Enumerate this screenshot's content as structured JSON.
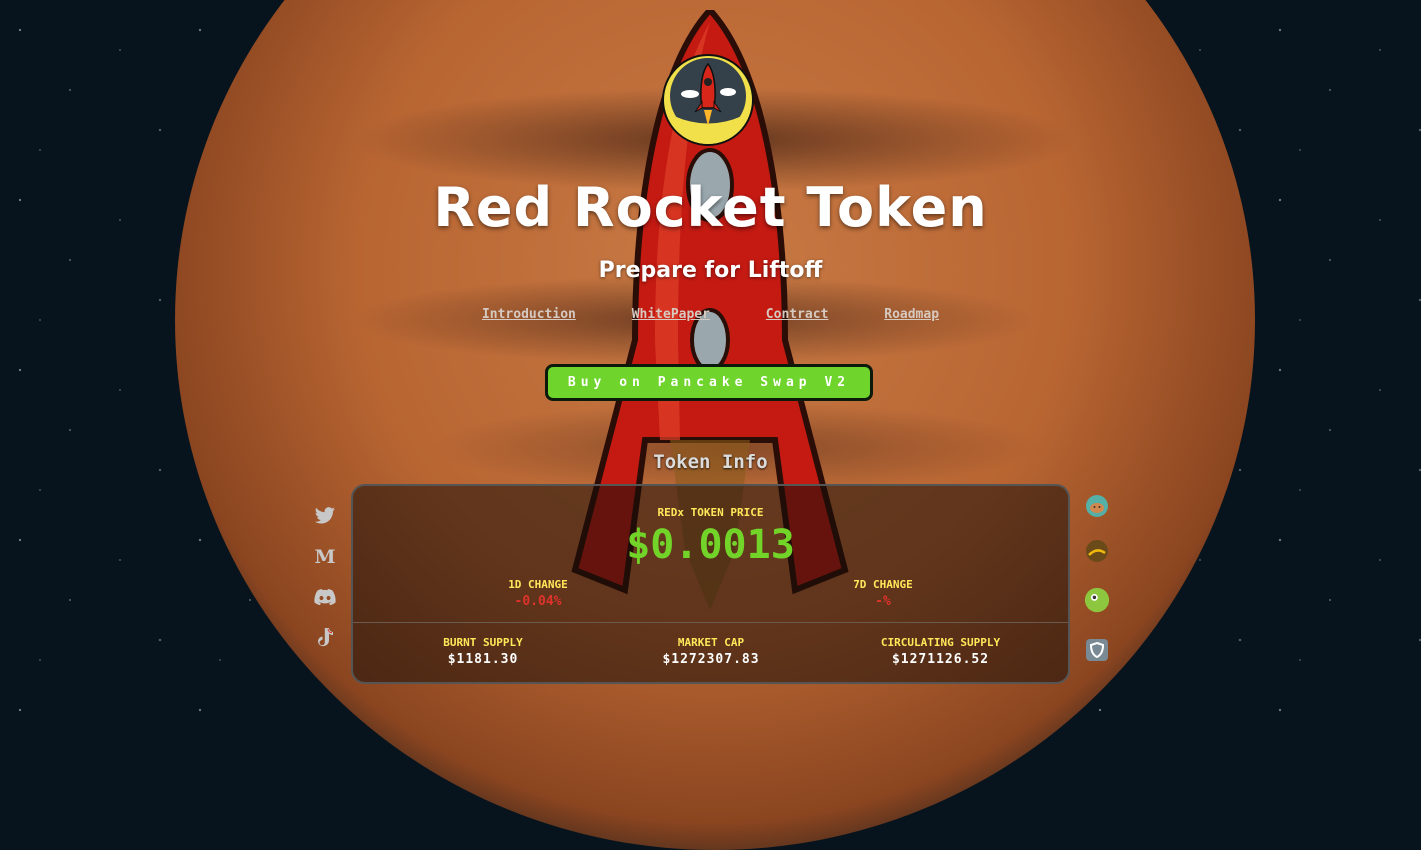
{
  "header": {
    "title": "Red Rocket Token",
    "subtitle": "Prepare for Liftoff"
  },
  "nav": [
    {
      "label": "Introduction"
    },
    {
      "label": "WhitePaper"
    },
    {
      "label": "Contract"
    },
    {
      "label": "Roadmap"
    }
  ],
  "buy_button": {
    "label": "Buy on Pancake Swap V2"
  },
  "token_info": {
    "heading": "Token Info",
    "price_label": "REDx TOKEN PRICE",
    "price": "$0.0013",
    "change_1d_label": "1D CHANGE",
    "change_1d": "-0.04%",
    "change_7d_label": "7D CHANGE",
    "change_7d": "-%",
    "burnt_label": "BURNT SUPPLY",
    "burnt": "$1181.30",
    "mcap_label": "MARKET CAP",
    "mcap": "$1272307.83",
    "circ_label": "CIRCULATING SUPPLY",
    "circ": "$1271126.52"
  },
  "social_icons": [
    "twitter-icon",
    "medium-icon",
    "discord-icon",
    "tiktok-icon"
  ],
  "partner_icons": [
    "pancakeswap-icon",
    "bscscan-icon",
    "coingecko-icon",
    "trustwallet-icon"
  ],
  "colors": {
    "accent_green": "#6fd52c",
    "price_green": "#72d429",
    "label_yellow": "#ffe95a",
    "negative_red": "#e0322d"
  }
}
